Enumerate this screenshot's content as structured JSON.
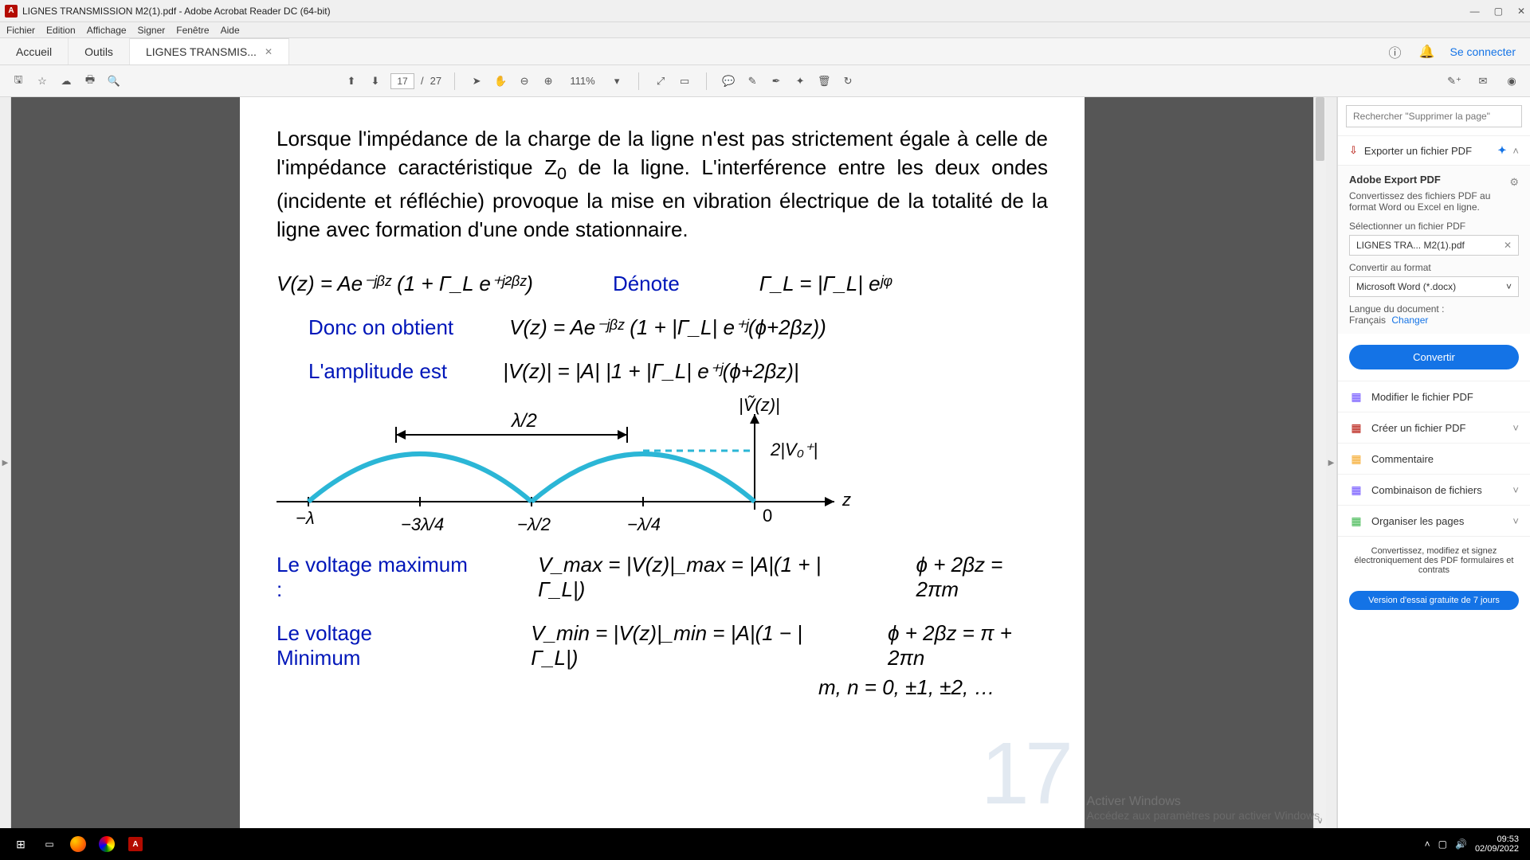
{
  "title": "LIGNES TRANSMISSION M2(1).pdf - Adobe Acrobat Reader DC (64-bit)",
  "menus": [
    "Fichier",
    "Edition",
    "Affichage",
    "Signer",
    "Fenêtre",
    "Aide"
  ],
  "tabs": {
    "home": "Accueil",
    "tools": "Outils",
    "doc": "LIGNES TRANSMIS...",
    "signin": "Se connecter"
  },
  "toolbar": {
    "page_current": "17",
    "page_total": "27",
    "page_sep": "/",
    "zoom": "111%"
  },
  "document": {
    "paragraph": "Lorsque l'impédance de la charge de la ligne n'est pas strictement égale à celle de l'impédance caractéristique Z",
    "paragraph_sub": "0",
    "paragraph2": " de la ligne. L'interférence entre les deux ondes (incidente et réfléchie) provoque la mise en vibration électrique de la totalité de la ligne avec formation d'une onde stationnaire.",
    "eq1": "V(z) = Ae⁻ʲᵝᶻ (1 + Γ_L e⁺ʲ²ᵝᶻ)",
    "denote": "Dénote",
    "eq_gamma": "Γ_L = |Γ_L| eʲᵠ",
    "donc": "Donc on obtient",
    "eq2": "V(z) = Ae⁻ʲᵝᶻ (1 + |Γ_L| e⁺ʲ(ϕ+2βz))",
    "amp": "L'amplitude est",
    "eq3": "|V(z)| = |A| |1 + |Γ_L| e⁺ʲ(ϕ+2βz)|",
    "vmax_label": "Le voltage maximum :",
    "vmax_eq": "V_max = |V(z)|_max = |A|(1 + |Γ_L|)",
    "vmax_phase": "ϕ + 2βz = 2πm",
    "vmin_label": "Le voltage Minimum",
    "vmin_eq": "V_min = |V(z)|_min = |A|(1 − |Γ_L|)",
    "vmin_phase": "ϕ + 2βz = π + 2πn",
    "mn": "m, n = 0, ±1, ±2, …",
    "graph": {
      "ylabel": "|Ṽ(z)|",
      "amp": "2|V₀⁺|",
      "zaxis": "z",
      "half": "λ/2",
      "ticks": [
        "−λ",
        "−3λ/4",
        "−λ/2",
        "−λ/4",
        "0"
      ]
    },
    "pagenum": "17"
  },
  "sidepanel": {
    "search_placeholder": "Rechercher \"Supprimer la page\"",
    "export_header": "Exporter un fichier PDF",
    "box_title": "Adobe Export PDF",
    "desc": "Convertissez des fichiers PDF au format Word ou Excel en ligne.",
    "select_label": "Sélectionner un fichier PDF",
    "file": "LIGNES TRA... M2(1).pdf",
    "convert_label": "Convertir au format",
    "format": "Microsoft Word (*.docx)",
    "lang_label": "Langue du document :",
    "lang_value": "Français",
    "lang_change": "Changer",
    "convert_btn": "Convertir",
    "tools": [
      {
        "icon": "edit-pdf-icon",
        "label": "Modifier le fichier PDF",
        "chev": false,
        "color": "#6a4cff"
      },
      {
        "icon": "create-pdf-icon",
        "label": "Créer un fichier PDF",
        "chev": true,
        "color": "#b30b00"
      },
      {
        "icon": "comment-icon",
        "label": "Commentaire",
        "chev": false,
        "color": "#f5a623"
      },
      {
        "icon": "combine-icon",
        "label": "Combinaison de fichiers",
        "chev": true,
        "color": "#6a4cff"
      },
      {
        "icon": "organize-icon",
        "label": "Organiser les pages",
        "chev": true,
        "color": "#39b54a"
      }
    ],
    "foot": "Convertissez, modifiez et signez électroniquement des PDF formulaires et contrats",
    "trial": "Version d'essai gratuite de 7 jours"
  },
  "watermark": {
    "l1": "Activer Windows",
    "l2": "Accédez aux paramètres pour activer Windows."
  },
  "taskbar": {
    "time": "09:53",
    "date": "02/09/2022"
  }
}
